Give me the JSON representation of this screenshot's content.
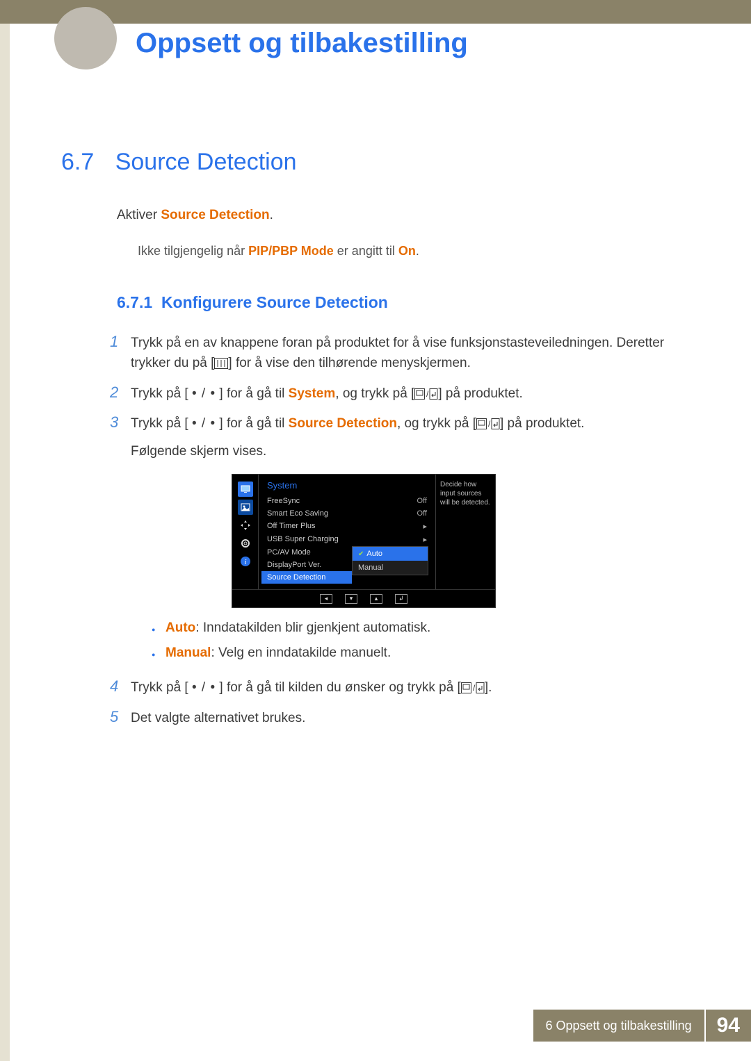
{
  "chapter_title": "Oppsett og tilbakestilling",
  "section": {
    "number": "6.7",
    "title": "Source Detection"
  },
  "intro": {
    "pre": "Aktiver ",
    "hl": "Source Detection",
    "post": "."
  },
  "note": {
    "pre": "Ikke tilgjengelig når ",
    "hl": "PIP/PBP Mode",
    "mid": " er angitt til ",
    "hl2": "On",
    "post": "."
  },
  "subsection": {
    "number": "6.7.1",
    "title": "Konfigurere Source Detection"
  },
  "steps": [
    {
      "n": "1",
      "pre": "Trykk på en av knappene foran på produktet for å vise funksjonstasteveiledningen. Deretter trykker du på [",
      "icon": "menu",
      "post": "] for å vise den tilhørende menyskjermen."
    },
    {
      "n": "2",
      "pre": "Trykk på [ ",
      "dots": "• / •",
      "mid": " ] for å gå til ",
      "hl": "System",
      "mid2": ", og trykk på [",
      "icon": "ok",
      "post": "] på produktet."
    },
    {
      "n": "3",
      "pre": "Trykk på [ ",
      "dots": "• / •",
      "mid": " ] for å gå til ",
      "hl": "Source Detection",
      "mid2": ", og trykk på [",
      "icon": "ok",
      "post": "] på produktet.",
      "after": "Følgende skjerm vises."
    },
    {
      "n": "4",
      "pre": "Trykk på [ ",
      "dots": "• / •",
      "mid": " ] for å gå til kilden du ønsker og trykk på [",
      "icon": "ok",
      "post": "]."
    },
    {
      "n": "5",
      "plain": "Det valgte alternativet brukes."
    }
  ],
  "bullets": [
    {
      "hl": "Auto",
      "post": ": Inndatakilden blir gjenkjent automatisk."
    },
    {
      "hl": "Manual",
      "post": ": Velg en inndatakilde manuelt."
    }
  ],
  "osd": {
    "tab": "System",
    "rows": [
      {
        "label": "FreeSync",
        "val": "Off"
      },
      {
        "label": "Smart Eco Saving",
        "val": "Off"
      },
      {
        "label": "Off Timer Plus",
        "val": "▸"
      },
      {
        "label": "USB Super Charging",
        "val": "▸"
      },
      {
        "label": "PC/AV Mode",
        "val": ""
      },
      {
        "label": "DisplayPort Ver.",
        "val": ""
      },
      {
        "label": "Source Detection",
        "val": "",
        "selected": true
      }
    ],
    "dropdown": {
      "selected": "Auto",
      "other": "Manual"
    },
    "help": "Decide how input sources will be detected."
  },
  "footer": {
    "text": "6 Oppsett og tilbakestilling",
    "page": "94"
  }
}
